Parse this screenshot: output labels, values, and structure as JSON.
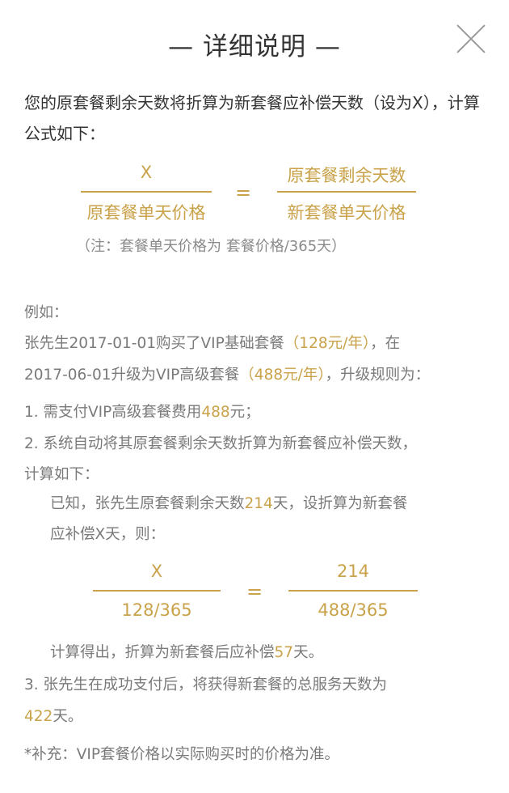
{
  "header": {
    "title": "— 详细说明 —"
  },
  "intro": "您的原套餐剩余天数将折算为新套餐应补偿天数（设为X），计算公式如下：",
  "formula": {
    "left_num": "X",
    "left_den": "原套餐单天价格",
    "equals": "=",
    "right_num": "原套餐剩余天数",
    "right_den": "新套餐单天价格",
    "note": "（注：套餐单天价格为 套餐价格/365天）"
  },
  "example": {
    "label": "例如：",
    "line1_a": "张先生2017-01-01购买了VIP基础套餐",
    "line1_b": "（128元/年）",
    "line1_c": "，在",
    "line2_a": "2017-06-01升级为VIP高级套餐",
    "line2_b": "（488元/年）",
    "line2_c": "，升级规则为：",
    "item1_a": "1. 需支付VIP高级套餐费用",
    "item1_b": "488",
    "item1_c": "元；",
    "item2_a": "2. 系统自动将其原套餐剩余天数折算为新套餐应补偿天数，",
    "item2_b": "计算如下：",
    "known_a": "已知，张先生原套餐剩余天数",
    "known_b": "214",
    "known_c": "天，设折算为新套餐",
    "known_d": "应补偿X天，则：",
    "f2_left_num": "X",
    "f2_left_den": "128/365",
    "f2_equals": "=",
    "f2_right_num": "214",
    "f2_right_den": "488/365",
    "result_a": "计算得出，折算为新套餐后应补偿",
    "result_b": "57",
    "result_c": "天。",
    "item3_a": "3. 张先生在成功支付后，将获得新套餐的总服务天数为",
    "item3_b": "422",
    "item3_c": "天。"
  },
  "footer": {
    "supplement": "*补充：VIP套餐价格以实际购买时的价格为准。"
  },
  "colors": {
    "accent": "#c9a24a",
    "text": "#333333",
    "muted": "#7a7a7a",
    "close": "#9a9a9a"
  }
}
